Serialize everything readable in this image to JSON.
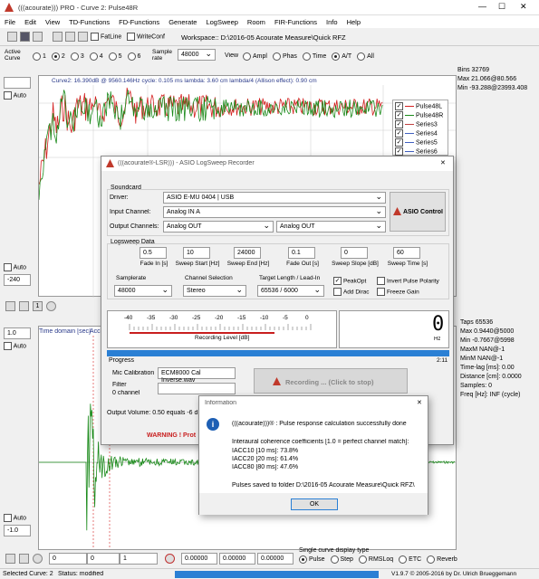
{
  "app": {
    "title": "(((acourate))) PRO - Curve 2: Pulse48R",
    "min": "—",
    "max": "☐",
    "close": "✕"
  },
  "menu": [
    "File",
    "Edit",
    "View",
    "TD-Functions",
    "FD-Functions",
    "Generate",
    "LogSweep",
    "Room",
    "FIR-Functions",
    "Info",
    "Help"
  ],
  "toolbar": {
    "fatline": "FatLine",
    "writeconf": "WriteConf",
    "workspace": "Workspace:: D:\\2016-05 Acourate Measure\\Quick RFZ"
  },
  "curvebar": {
    "active_label": "Active Curve",
    "curves": [
      "1",
      "2",
      "3",
      "4",
      "5",
      "6"
    ],
    "selected": "2",
    "samplerate_label": "Sample rate",
    "samplerate": "48000",
    "view_label": "View",
    "views": [
      "Ampl",
      "Phas",
      "Time",
      "A/T",
      "All"
    ],
    "view_selected": "A/T"
  },
  "top_plot": {
    "info": "Curve2: 16.390dB @ 9560.146Hz   cycle: 0.105 ms   lambda: 3.60 cm   lambda/4 (Allison effect): 0.90 cm",
    "auto": "Auto",
    "value": "-240",
    "legend": [
      "Pulse48L",
      "Pulse48R",
      "Series3",
      "Series4",
      "Series5",
      "Series6"
    ],
    "legend_colors": [
      "#d42020",
      "#1a8a1a",
      "#c04040",
      "#4060c0",
      "#4060c0",
      "#4060c0"
    ]
  },
  "right_top": {
    "bins": "Bins 32769",
    "max": "Max 21.066@80.566",
    "min": "Min -93.288@23993.408"
  },
  "zoom": {
    "one": "1"
  },
  "bottom_plot": {
    "header": "Time domain [sec]",
    "header2": "Acc",
    "value_top": "1.0",
    "auto": "Auto",
    "value_bottom": "-1.0"
  },
  "right_bottom": {
    "taps": "Taps 65536",
    "max": "Max 0.9440@5000",
    "min": "Min -0.7667@5998",
    "maxm": "MaxM NAN@-1",
    "minm": "MinM NAN@-1",
    "timelag": "Time-lag [ms]: 0.00",
    "distance": "Distance [cm]: 0.0000",
    "samples": "Samples:  0",
    "freq": "Freq [Hz]: INF (cycle)"
  },
  "bottombar": {
    "f1": "0",
    "f2": "0",
    "f3": "1",
    "f4": "0.00000",
    "f5": "0.00000",
    "f6": "0.00000",
    "single_label": "Single curve display type",
    "types": [
      "Pulse",
      "Step",
      "RMSLoq",
      "ETC",
      "Reverb"
    ]
  },
  "statusbar": {
    "selected": "Selected Curve: 2",
    "status": "Status: modified",
    "version": "V1.9.7 © 2005-2016 by Dr. Ulrich Brueggemann"
  },
  "recorder": {
    "title": "(((acourate®-LSR))) - ASIO LogSweep Recorder",
    "soundcard": "Soundcard",
    "driver_label": "Driver:",
    "driver": "ASIO E-MU 0404 | USB",
    "input_label": "Input Channel:",
    "input": "Analog IN A",
    "output_label": "Output Channels:",
    "out1": "Analog OUT",
    "out2": "Analog OUT",
    "asio_button": "ASIO Control",
    "logsweep_data": "Logsweep Data",
    "params": [
      {
        "v": "0.5",
        "l": "Fade In [s]"
      },
      {
        "v": "10",
        "l": "Sweep Start [Hz]"
      },
      {
        "v": "24000",
        "l": "Sweep End [Hz]"
      },
      {
        "v": "0.1",
        "l": "Fade Out [s]"
      },
      {
        "v": "0",
        "l": "Sweep Slope [dB]"
      },
      {
        "v": "60",
        "l": "Sweep Time [s]"
      }
    ],
    "samplerate_label": "Samplerate",
    "samplerate": "48000",
    "channel_label": "Channel Selection",
    "channel": "Stereo",
    "target_label": "Target Length / Lead-In",
    "target": "65536 / 6000",
    "peakopt": "PeakOpt",
    "invert": "Invert Pulse Polarity",
    "adddirac": "Add Dirac",
    "freeze": "Freeze Gain",
    "scale": [
      "-40",
      "-35",
      "-30",
      "-25",
      "-20",
      "-15",
      "-10",
      "-5",
      "0"
    ],
    "recording_level": "Recording Level [dB]",
    "display_digit": "0",
    "display_unit": "Hz",
    "time": "2:11",
    "progress": "Progress",
    "mic_label": "Mic Calibration",
    "mic": "ECM8000 Cal Inverse.wav",
    "filter_label": "Filter",
    "filter_channel": "0 channel",
    "recording_button": "Recording ... (Click to stop)",
    "output_volume": "Output Volume: 0.50 equals -6 dB",
    "warning": "WARNING ! Prot"
  },
  "info": {
    "title": "Information",
    "line1": "(((acourate)))® :  Pulse response calculation successfully done",
    "line2": "Interaural coherence coefficients [1.0 = perfect channel match]:",
    "iacc10": "IACC10 [10 ms]: 73.8%",
    "iacc20": "IACC20 [20 ms]: 61.4%",
    "iacc80": "IACC80 [80 ms]: 47.6%",
    "line3": "Pulses saved to folder D:\\2016-05 Acourate Measure\\Quick RFZ\\",
    "ok": "OK"
  }
}
